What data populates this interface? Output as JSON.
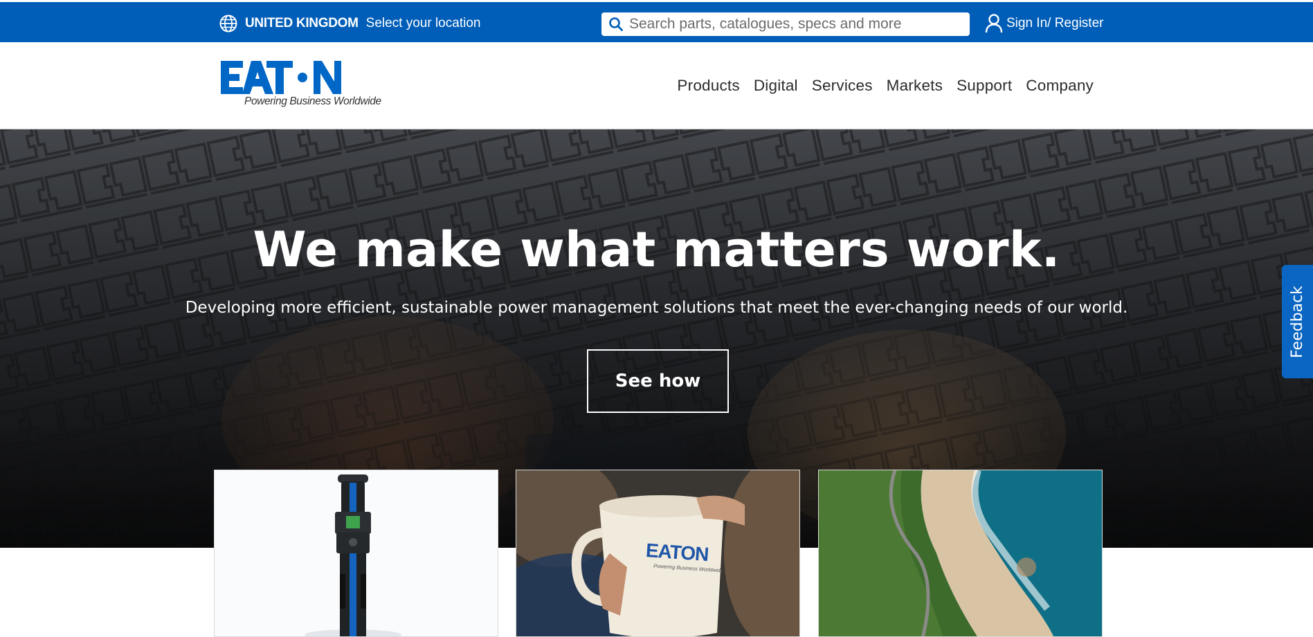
{
  "topbar": {
    "country": "UNITED KINGDOM",
    "select_location": "Select your location",
    "search_placeholder": "Search parts, catalogues, specs and more",
    "sign_in": "Sign In/ Register",
    "background_color": "#005eb8"
  },
  "header": {
    "logo_text": "EATON",
    "tagline": "Powering Business Worldwide",
    "nav": [
      "Products",
      "Digital",
      "Services",
      "Markets",
      "Support",
      "Company"
    ],
    "brand_color": "#0067c6"
  },
  "hero": {
    "title": "We make what matters work.",
    "subtitle": "Developing more efficient, sustainable power management solutions that meet the ever-changing needs of our world.",
    "cta": "See how"
  },
  "feedback": {
    "label": "Feedback",
    "color": "#0a66c2"
  },
  "cards": [
    {
      "name": "ev-charger",
      "icon": "ev-charger-image"
    },
    {
      "name": "eaton-mug",
      "icon": "mug-image",
      "mug_logo": "EATON",
      "mug_tagline": "Powering Business Worldwide"
    },
    {
      "name": "coastal-road",
      "icon": "coast-image"
    }
  ]
}
